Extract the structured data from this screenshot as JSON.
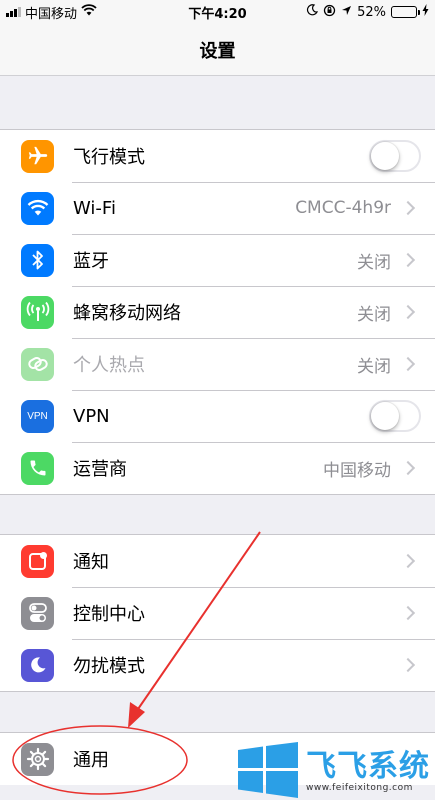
{
  "status_bar": {
    "carrier": "中国移动",
    "time": "下午4:20",
    "battery": "52%",
    "battery_level": 0.52
  },
  "nav": {
    "title": "设置"
  },
  "groups": {
    "connectivity": [
      {
        "label": "飞行模式",
        "icon": "airplane-icon",
        "color": "#ff9500",
        "control": "toggle",
        "on": false
      },
      {
        "label": "Wi-Fi",
        "icon": "wifi-icon",
        "color": "#007aff",
        "value": "CMCC-4h9r"
      },
      {
        "label": "蓝牙",
        "icon": "bluetooth-icon",
        "color": "#007aff",
        "value": "关闭"
      },
      {
        "label": "蜂窝移动网络",
        "icon": "antenna-icon",
        "color": "#4cd964",
        "value": "关闭"
      },
      {
        "label": "个人热点",
        "icon": "chain-link-icon",
        "color": "#a3e3a6",
        "value": "关闭",
        "disabled": true
      },
      {
        "label": "VPN",
        "icon": "vpn-icon",
        "color": "#1a6fe0",
        "icon_text": "VPN",
        "control": "toggle",
        "on": false
      },
      {
        "label": "运营商",
        "icon": "phone-icon",
        "color": "#4cd964",
        "value": "中国移动"
      }
    ],
    "system": [
      {
        "label": "通知",
        "icon": "notifications-icon",
        "color": "#ff3b30"
      },
      {
        "label": "控制中心",
        "icon": "control-center-icon",
        "color": "#8e8e93"
      },
      {
        "label": "勿扰模式",
        "icon": "moon-icon",
        "color": "#5856d6"
      }
    ],
    "general": [
      {
        "label": "通用",
        "icon": "gear-icon",
        "color": "#8e8e93"
      }
    ]
  },
  "watermark": {
    "title": "飞飞系统",
    "url": "www.feifeixitong.com"
  },
  "colors": {
    "annotation": "#e8312e",
    "watermark": "#2b9fe6"
  }
}
